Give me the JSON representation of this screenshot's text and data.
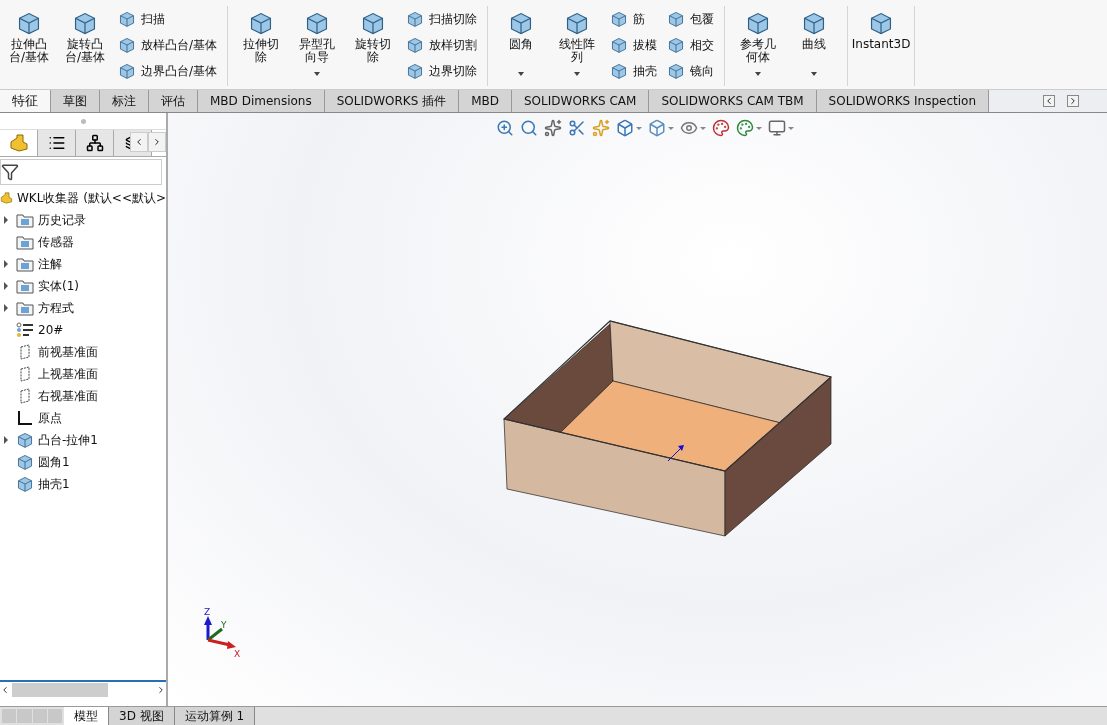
{
  "ribbon": {
    "groups": [
      {
        "large": [
          {
            "label": "拉伸凸台/基体",
            "dropdown": false
          },
          {
            "label": "旋转凸台/基体",
            "dropdown": false
          }
        ],
        "small_columns": [
          [
            {
              "label": "扫描"
            },
            {
              "label": "放样凸台/基体"
            },
            {
              "label": "边界凸台/基体"
            }
          ]
        ]
      },
      {
        "large": [
          {
            "label": "拉伸切除",
            "dropdown": false
          },
          {
            "label": "异型孔向导",
            "dropdown": true
          },
          {
            "label": "旋转切除",
            "dropdown": false
          }
        ],
        "small_columns": [
          [
            {
              "label": "扫描切除"
            },
            {
              "label": "放样切割"
            },
            {
              "label": "边界切除"
            }
          ]
        ]
      },
      {
        "large": [
          {
            "label": "圆角",
            "dropdown": true
          },
          {
            "label": "线性阵列",
            "dropdown": true
          }
        ],
        "small_columns": [
          [
            {
              "label": "筋"
            },
            {
              "label": "拔模"
            },
            {
              "label": "抽壳"
            }
          ],
          [
            {
              "label": "包覆"
            },
            {
              "label": "相交"
            },
            {
              "label": "镜向"
            }
          ]
        ]
      },
      {
        "large": [
          {
            "label": "参考几何体",
            "dropdown": true
          },
          {
            "label": "曲线",
            "dropdown": true
          }
        ]
      },
      {
        "large": [
          {
            "label": "Instant3D",
            "dropdown": false
          }
        ]
      }
    ]
  },
  "tabs": [
    {
      "label": "特征",
      "selected": true
    },
    {
      "label": "草图",
      "selected": false
    },
    {
      "label": "标注",
      "selected": false
    },
    {
      "label": "评估",
      "selected": false
    },
    {
      "label": "MBD Dimensions",
      "selected": false
    },
    {
      "label": "SOLIDWORKS 插件",
      "selected": false
    },
    {
      "label": "MBD",
      "selected": false
    },
    {
      "label": "SOLIDWORKS CAM",
      "selected": false
    },
    {
      "label": "SOLIDWORKS CAM TBM",
      "selected": false
    },
    {
      "label": "SOLIDWORKS Inspection",
      "selected": false
    }
  ],
  "panel_tabs": [
    {
      "kind": "part",
      "selected": true
    },
    {
      "kind": "list",
      "selected": false
    },
    {
      "kind": "tree",
      "selected": false
    },
    {
      "kind": "other",
      "selected": false
    }
  ],
  "tree": {
    "root": "WKL收集器 (默认<<默认>",
    "items": [
      {
        "label": "历史记录",
        "kind": "folder",
        "expandable": true
      },
      {
        "label": "传感器",
        "kind": "folder",
        "expandable": false
      },
      {
        "label": "注解",
        "kind": "folder",
        "expandable": true
      },
      {
        "label": "实体(1)",
        "kind": "folder",
        "expandable": true
      },
      {
        "label": "方程式",
        "kind": "folder",
        "expandable": true
      },
      {
        "label": "20#",
        "kind": "material",
        "expandable": false
      },
      {
        "label": "前视基准面",
        "kind": "plane",
        "expandable": false
      },
      {
        "label": "上视基准面",
        "kind": "plane",
        "expandable": false
      },
      {
        "label": "右视基准面",
        "kind": "plane",
        "expandable": false
      },
      {
        "label": "原点",
        "kind": "origin",
        "expandable": false
      },
      {
        "label": "凸台-拉伸1",
        "kind": "feature",
        "expandable": true
      },
      {
        "label": "圆角1",
        "kind": "feature",
        "expandable": false
      },
      {
        "label": "抽壳1",
        "kind": "feature",
        "expandable": false
      }
    ]
  },
  "triad": {
    "x": "X",
    "y": "Y",
    "z": "Z"
  },
  "bottom_tabs": [
    {
      "label": "模型",
      "selected": true
    },
    {
      "label": "3D 视图",
      "selected": false
    },
    {
      "label": "运动算例 1",
      "selected": false
    }
  ]
}
